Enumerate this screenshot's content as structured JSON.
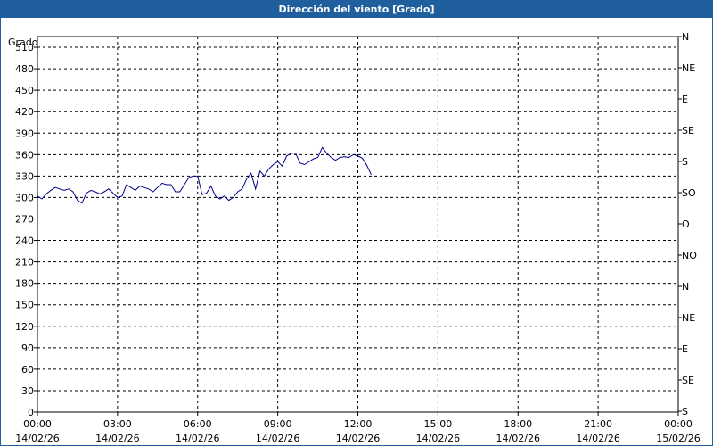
{
  "window": {
    "title": "Dirección del viento [Grado]"
  },
  "chart_data": {
    "type": "line",
    "title": "Dirección del viento [Grado]",
    "ylabel": "Grado",
    "ylim": [
      0,
      525
    ],
    "xlim": [
      "2026-02-14T00:00",
      "2026-02-15T00:00"
    ],
    "grid": true,
    "line_color": "#00008b",
    "y_ticks": [
      0,
      30,
      60,
      90,
      120,
      150,
      180,
      210,
      240,
      270,
      300,
      330,
      360,
      390,
      420,
      450,
      480,
      510
    ],
    "right_ticks": [
      {
        "value": 0,
        "label": "N"
      },
      {
        "value": 45,
        "label": "NE"
      },
      {
        "value": 90,
        "label": "E"
      },
      {
        "value": 135,
        "label": "SE"
      },
      {
        "value": 180,
        "label": "S"
      },
      {
        "value": 225,
        "label": "SO"
      },
      {
        "value": 270,
        "label": "O"
      },
      {
        "value": 315,
        "label": "NO"
      },
      {
        "value": 360,
        "label": "N"
      },
      {
        "value": 405,
        "label": "NE"
      },
      {
        "value": 450,
        "label": "E"
      },
      {
        "value": 495,
        "label": "SE"
      },
      {
        "value": 540,
        "label": "S"
      }
    ],
    "x_ticks": [
      {
        "time": "00:00",
        "date": "14/02/26"
      },
      {
        "time": "03:00",
        "date": "14/02/26"
      },
      {
        "time": "06:00",
        "date": "14/02/26"
      },
      {
        "time": "09:00",
        "date": "14/02/26"
      },
      {
        "time": "12:00",
        "date": "14/02/26"
      },
      {
        "time": "15:00",
        "date": "14/02/26"
      },
      {
        "time": "18:00",
        "date": "14/02/26"
      },
      {
        "time": "21:00",
        "date": "14/02/26"
      },
      {
        "time": "00:00",
        "date": "15/02/26"
      }
    ],
    "series": [
      {
        "x": [
          "00:00",
          "00:10",
          "00:20",
          "00:30",
          "00:40",
          "00:50",
          "01:00",
          "01:10",
          "01:20",
          "01:30",
          "01:40",
          "01:50",
          "02:00",
          "02:10",
          "02:20",
          "02:30",
          "02:40",
          "02:50",
          "03:00",
          "03:10",
          "03:20",
          "03:30",
          "03:40",
          "03:50",
          "04:00",
          "04:10",
          "04:20",
          "04:30",
          "04:40",
          "04:50",
          "05:00",
          "05:10",
          "05:20",
          "05:30",
          "05:40",
          "05:50",
          "06:00",
          "06:10",
          "06:20",
          "06:30",
          "06:40",
          "06:50",
          "07:00",
          "07:10",
          "07:20",
          "07:30",
          "07:40",
          "07:50",
          "08:00",
          "08:10",
          "08:20",
          "08:30",
          "08:40",
          "08:50",
          "09:00",
          "09:10",
          "09:20",
          "09:30",
          "09:40",
          "09:50",
          "10:00",
          "10:10",
          "10:20",
          "10:30",
          "10:40",
          "10:50",
          "11:00",
          "11:10",
          "11:20",
          "11:30",
          "11:40",
          "11:50",
          "12:00",
          "12:10",
          "12:20",
          "12:30"
        ],
        "values": [
          302,
          298,
          305,
          310,
          314,
          312,
          310,
          312,
          308,
          296,
          292,
          306,
          310,
          308,
          305,
          308,
          312,
          306,
          300,
          302,
          318,
          314,
          310,
          316,
          314,
          312,
          308,
          314,
          320,
          318,
          318,
          308,
          308,
          318,
          328,
          330,
          330,
          304,
          306,
          316,
          302,
          298,
          302,
          296,
          300,
          308,
          312,
          326,
          334,
          312,
          337,
          330,
          340,
          346,
          350,
          344,
          358,
          362,
          362,
          348,
          346,
          350,
          354,
          356,
          370,
          362,
          356,
          352,
          356,
          357,
          356,
          360,
          358,
          355,
          345,
          332
        ]
      }
    ]
  }
}
